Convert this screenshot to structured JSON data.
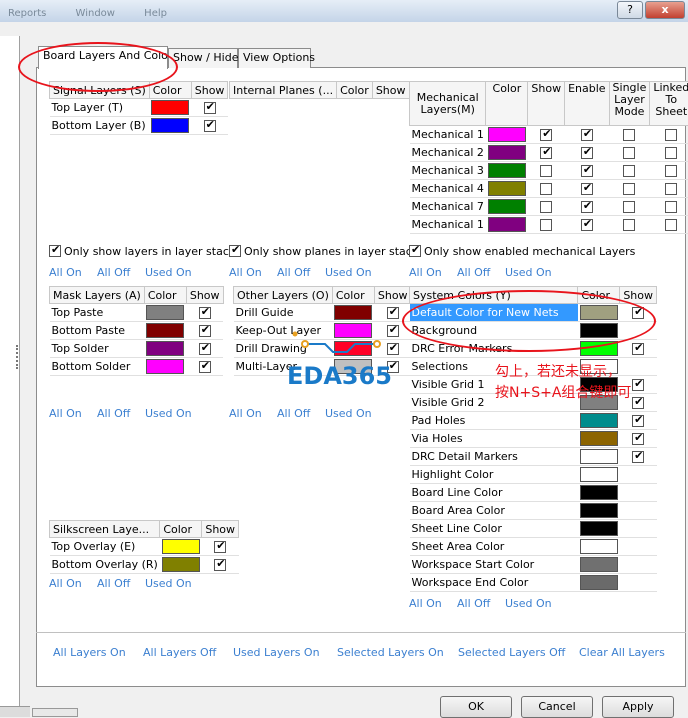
{
  "window": {
    "menu": [
      "Reports",
      "Window",
      "Help"
    ],
    "help_btn": "?",
    "close_btn": "x"
  },
  "tabs": [
    "Board Layers And Colors",
    "Show / Hide",
    "View Options"
  ],
  "common": {
    "all_on": "All On",
    "all_off": "All Off",
    "used_on": "Used On",
    "color": "Color",
    "show": "Show"
  },
  "signal_layers": {
    "header": "Signal Layers (S)",
    "rows": [
      {
        "name": "Top Layer (T)",
        "color": "#ff0000",
        "show": true
      },
      {
        "name": "Bottom Layer (B)",
        "color": "#0000ff",
        "show": true
      }
    ],
    "only_show_label": "Only show layers in layer stack",
    "only_show_checked": true
  },
  "internal_planes": {
    "header": "Internal Planes (...",
    "only_show_label": "Only show planes in layer stack",
    "only_show_checked": true
  },
  "mechanical": {
    "headers": [
      "Mechanical Layers(M)",
      "Color",
      "Show",
      "Enable",
      "Single Layer Mode",
      "Linked To Sheet"
    ],
    "rows": [
      {
        "name": "Mechanical 1",
        "color": "#ff00ff",
        "show": true,
        "enable": true,
        "single": false,
        "linked": false
      },
      {
        "name": "Mechanical 2",
        "color": "#800080",
        "show": true,
        "enable": true,
        "single": false,
        "linked": false
      },
      {
        "name": "Mechanical 3",
        "color": "#008000",
        "show": false,
        "enable": true,
        "single": false,
        "linked": false
      },
      {
        "name": "Mechanical 4",
        "color": "#808000",
        "show": false,
        "enable": true,
        "single": false,
        "linked": false
      },
      {
        "name": "Mechanical 7",
        "color": "#008000",
        "show": false,
        "enable": true,
        "single": false,
        "linked": false
      },
      {
        "name": "Mechanical 1",
        "color": "#800080",
        "show": false,
        "enable": true,
        "single": false,
        "linked": false
      }
    ],
    "only_show_label": "Only show enabled mechanical Layers",
    "only_show_checked": true
  },
  "mask_layers": {
    "header": "Mask Layers (A)",
    "rows": [
      {
        "name": "Top Paste",
        "color": "#808080",
        "show": true
      },
      {
        "name": "Bottom Paste",
        "color": "#800000",
        "show": true
      },
      {
        "name": "Top Solder",
        "color": "#800080",
        "show": true
      },
      {
        "name": "Bottom Solder",
        "color": "#ff00ff",
        "show": true
      }
    ]
  },
  "other_layers": {
    "header": "Other Layers (O)",
    "rows": [
      {
        "name": "Drill Guide",
        "color": "#800000",
        "show": true
      },
      {
        "name": "Keep-Out Layer",
        "color": "#ff00ff",
        "show": true
      },
      {
        "name": "Drill Drawing",
        "color": "#ff0026",
        "show": true
      },
      {
        "name": "Multi-Layer",
        "color": "#c0c0c0",
        "show": true
      }
    ]
  },
  "system_colors": {
    "header": "System Colors (Y)",
    "rows": [
      {
        "name": "Default Color for New Nets",
        "color": "#a0a080",
        "show": true,
        "has_show": true,
        "selected": true
      },
      {
        "name": "Background",
        "color": "#000000",
        "show": false,
        "has_show": false,
        "selected": false
      },
      {
        "name": "DRC Error Markers",
        "color": "#00ff00",
        "show": true,
        "has_show": true,
        "selected": false
      },
      {
        "name": "Selections",
        "color": "#ffffff",
        "show": false,
        "has_show": false,
        "selected": false
      },
      {
        "name": "Visible Grid 1",
        "color": "#000000",
        "show": true,
        "has_show": true,
        "selected": false
      },
      {
        "name": "Visible Grid 2",
        "color": "#808080",
        "show": true,
        "has_show": true,
        "selected": false
      },
      {
        "name": "Pad Holes",
        "color": "#008c8c",
        "show": true,
        "has_show": true,
        "selected": false
      },
      {
        "name": "Via Holes",
        "color": "#8c6400",
        "show": true,
        "has_show": true,
        "selected": false
      },
      {
        "name": "DRC Detail Markers",
        "color": "#ffffff",
        "show": true,
        "has_show": true,
        "selected": false
      },
      {
        "name": "Highlight Color",
        "color": "#ffffff",
        "show": false,
        "has_show": false,
        "selected": false
      },
      {
        "name": "Board Line Color",
        "color": "#000000",
        "show": false,
        "has_show": false,
        "selected": false
      },
      {
        "name": "Board Area Color",
        "color": "#000000",
        "show": false,
        "has_show": false,
        "selected": false
      },
      {
        "name": "Sheet Line Color",
        "color": "#000000",
        "show": false,
        "has_show": false,
        "selected": false
      },
      {
        "name": "Sheet Area Color",
        "color": "#ffffff",
        "show": false,
        "has_show": false,
        "selected": false
      },
      {
        "name": "Workspace Start Color",
        "color": "#707070",
        "show": false,
        "has_show": false,
        "selected": false
      },
      {
        "name": "Workspace End Color",
        "color": "#6a6a6a",
        "show": false,
        "has_show": false,
        "selected": false
      }
    ]
  },
  "silkscreen": {
    "header": "Silkscreen Laye...",
    "rows": [
      {
        "name": "Top Overlay (E)",
        "color": "#ffff00",
        "show": true
      },
      {
        "name": "Bottom Overlay (R)",
        "color": "#808000",
        "show": true
      }
    ]
  },
  "bottom_links": [
    "All Layers On",
    "All Layers Off",
    "Used Layers On",
    "Selected Layers On",
    "Selected Layers Off",
    "Clear All Layers"
  ],
  "buttons": {
    "ok": "OK",
    "cancel": "Cancel",
    "apply": "Apply"
  },
  "watermark": "EDA365",
  "annotation_lines": [
    "勾上，若还未显示，",
    "按N+S+A组合键即可"
  ]
}
